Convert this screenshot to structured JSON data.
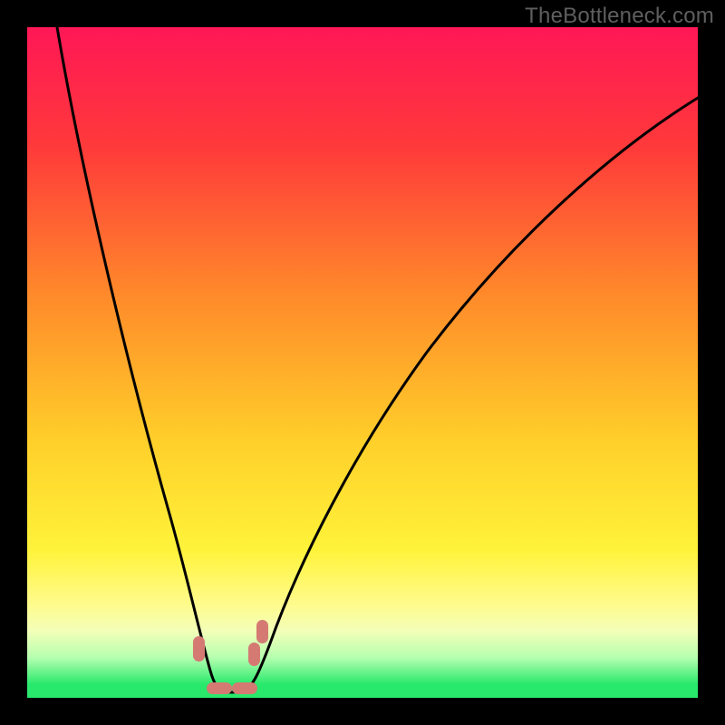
{
  "branding": {
    "watermark": "TheBottleneck.com"
  },
  "colors": {
    "bg": "#000000",
    "gradient_stops": [
      {
        "pct": 0,
        "color": "#ff1756"
      },
      {
        "pct": 18,
        "color": "#ff3a3a"
      },
      {
        "pct": 40,
        "color": "#ff8a2a"
      },
      {
        "pct": 62,
        "color": "#ffd02a"
      },
      {
        "pct": 78,
        "color": "#fff33a"
      },
      {
        "pct": 86,
        "color": "#fffb8c"
      },
      {
        "pct": 90,
        "color": "#f3ffb8"
      },
      {
        "pct": 94,
        "color": "#b6ffb0"
      },
      {
        "pct": 98,
        "color": "#28e96b"
      },
      {
        "pct": 100,
        "color": "#28e96b"
      }
    ],
    "curve": "#000000",
    "marker": "#d47a73"
  },
  "chart_data": {
    "type": "line",
    "title": "",
    "xlabel": "",
    "ylabel": "",
    "x_range": [
      0,
      100
    ],
    "y_range": [
      0,
      100
    ],
    "note": "V-shaped bottleneck curve; y≈100 at edges, touching 0 near x≈27–33. Values estimated from pixels.",
    "series": [
      {
        "name": "bottleneck-curve",
        "x": [
          4,
          8,
          12,
          16,
          20,
          23,
          26,
          28,
          30,
          32,
          34,
          36,
          40,
          45,
          50,
          55,
          60,
          66,
          72,
          80,
          88,
          96,
          100
        ],
        "y": [
          100,
          88,
          75,
          62,
          47,
          32,
          14,
          3,
          0,
          0,
          3,
          10,
          23,
          36,
          47,
          56,
          63,
          70,
          76,
          82,
          87,
          90,
          91
        ]
      }
    ],
    "markers": [
      {
        "x": 25.5,
        "y": 6.5,
        "shape": "pill"
      },
      {
        "x": 28.0,
        "y": 1.0,
        "shape": "pill-h"
      },
      {
        "x": 32.0,
        "y": 1.0,
        "shape": "pill-h"
      },
      {
        "x": 34.0,
        "y": 6.0,
        "shape": "pill"
      },
      {
        "x": 35.0,
        "y": 10.0,
        "shape": "pill"
      }
    ]
  }
}
